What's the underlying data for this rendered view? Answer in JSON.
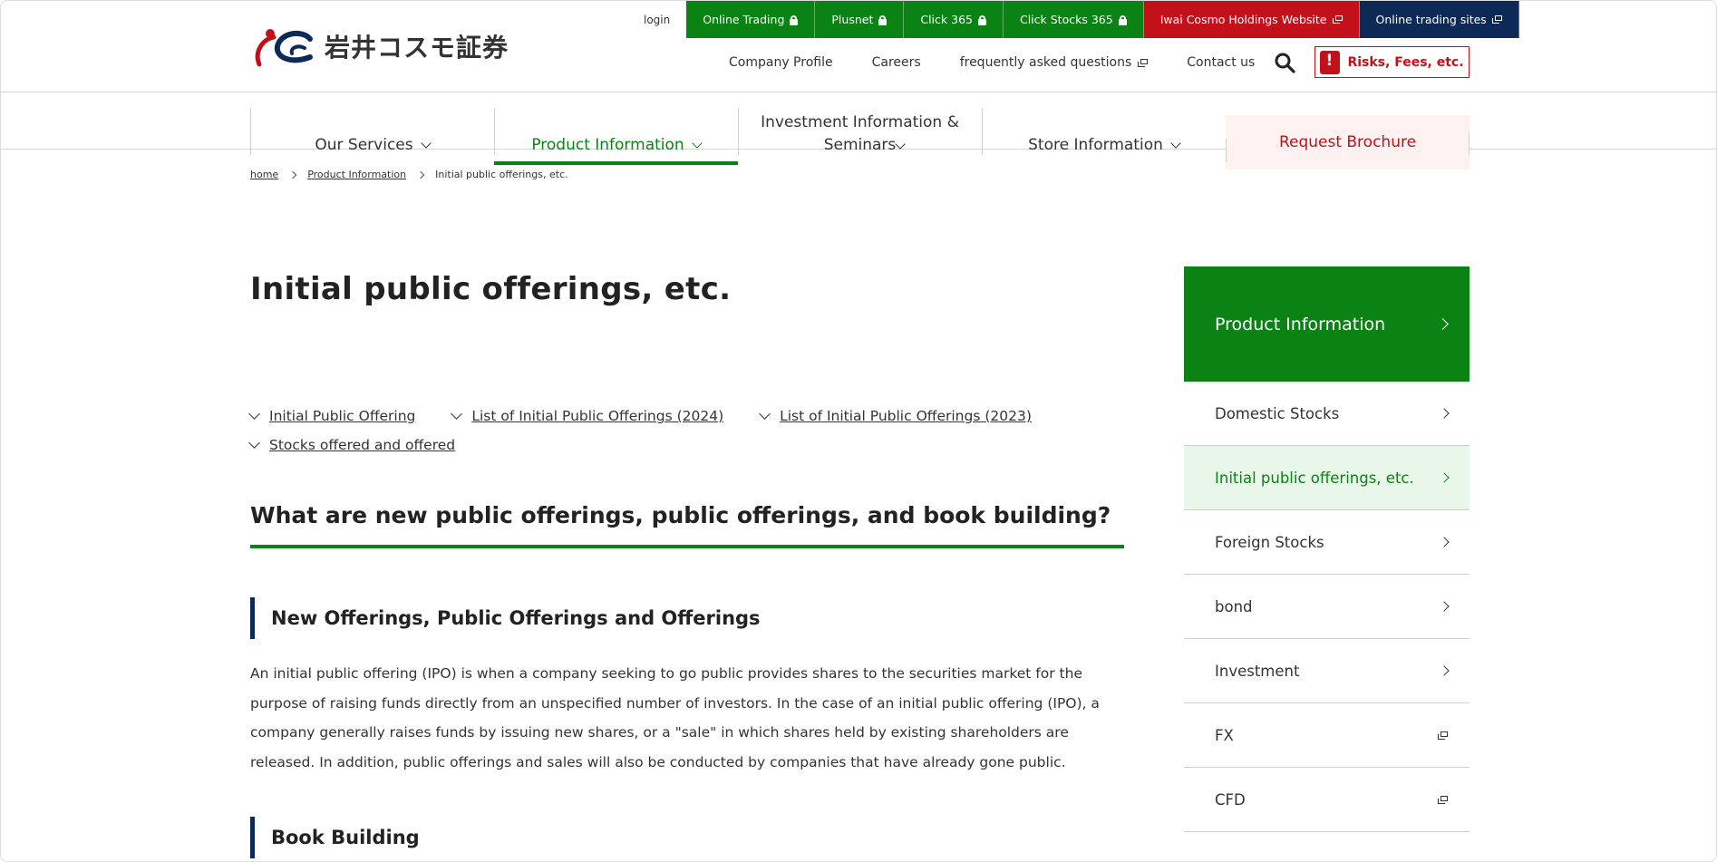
{
  "brand": {
    "logo_text": "岩井コスモ証券"
  },
  "top_links": {
    "login": "login",
    "buttons": [
      {
        "label": "Online Trading",
        "icon": "lock-icon",
        "color": "#0b8214"
      },
      {
        "label": "Plusnet",
        "icon": "lock-icon",
        "color": "#0b8214"
      },
      {
        "label": "Click 365",
        "icon": "lock-icon",
        "color": "#0b8214"
      },
      {
        "label": "Click Stocks 365",
        "icon": "lock-icon",
        "color": "#0b8214"
      },
      {
        "label": "Iwai Cosmo Holdings Website",
        "icon": "external-link-icon",
        "color": "#c3111b"
      },
      {
        "label": "Online trading sites",
        "icon": "external-link-icon",
        "color": "#0d2a57"
      }
    ]
  },
  "sub_links": {
    "company": "Company Profile",
    "careers": "Careers",
    "faq": "frequently asked questions",
    "contact": "Contact us",
    "risk": "Risks, Fees, etc."
  },
  "gnav": {
    "services": "Our Services",
    "products": "Product Information",
    "investment": "Investment Information & Seminars",
    "store": "Store Information",
    "brochure": "Request Brochure"
  },
  "breadcrumb": {
    "home": "home",
    "product": "Product Information",
    "current": "Initial public offerings, etc."
  },
  "main": {
    "title": "Initial public offerings, etc.",
    "anchors": [
      "Initial Public Offering",
      "List of Initial Public Offerings (2024)",
      "List of Initial Public Offerings (2023)",
      "Stocks offered and offered"
    ],
    "h2": "What are new public offerings, public offerings, and book building?",
    "h3": "New Offerings, Public Offerings and Offerings",
    "paragraph": "An initial public offering (IPO) is when a company seeking to go public provides shares to the securities market for the purpose of raising funds directly from an unspecified number of investors. In the case of an initial public offering (IPO), a company generally raises funds by issuing new shares, or a \"sale\" in which shares held by existing shareholders are released. In addition, public offerings and sales will also be conducted by companies that have already gone public.",
    "h3b": "Book Building"
  },
  "side": {
    "head": "Product Information",
    "items": [
      {
        "label": "Domestic Stocks",
        "icon": "chevron-right-icon"
      },
      {
        "label": "Initial public offerings, etc.",
        "icon": "chevron-right-icon",
        "active": true
      },
      {
        "label": "Foreign Stocks",
        "icon": "chevron-right-icon"
      },
      {
        "label": "bond",
        "icon": "chevron-right-icon"
      },
      {
        "label": "Investment",
        "icon": "chevron-right-icon"
      },
      {
        "label": "FX",
        "icon": "external-link-icon"
      },
      {
        "label": "CFD",
        "icon": "external-link-icon"
      }
    ]
  },
  "colors": {
    "brand_green": "#0b8214",
    "brand_red": "#c3111b",
    "navy": "#0d2a57",
    "active_bg": "#e9f7ea",
    "brochure_bg": "#fdf1f1"
  }
}
